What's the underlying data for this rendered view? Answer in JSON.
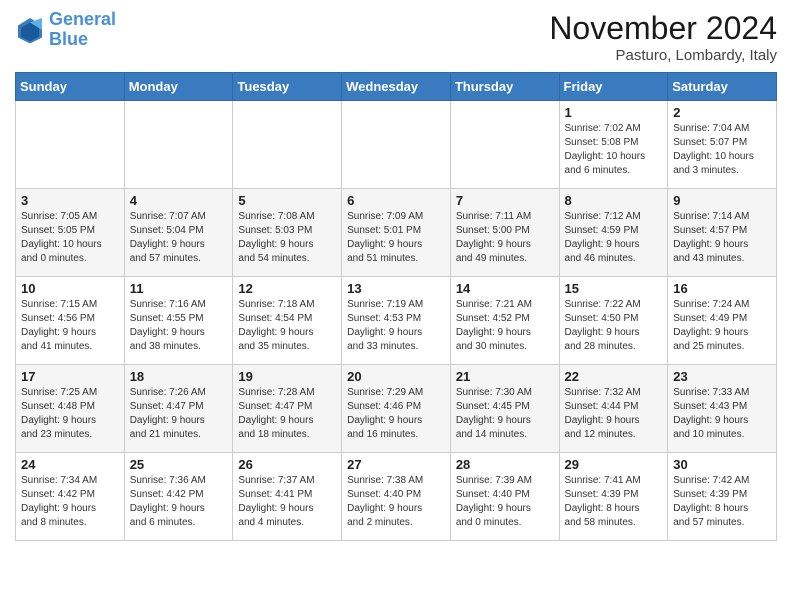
{
  "header": {
    "logo_line1": "General",
    "logo_line2": "Blue",
    "month_title": "November 2024",
    "location": "Pasturo, Lombardy, Italy"
  },
  "weekdays": [
    "Sunday",
    "Monday",
    "Tuesday",
    "Wednesday",
    "Thursday",
    "Friday",
    "Saturday"
  ],
  "weeks": [
    [
      {
        "day": "",
        "info": ""
      },
      {
        "day": "",
        "info": ""
      },
      {
        "day": "",
        "info": ""
      },
      {
        "day": "",
        "info": ""
      },
      {
        "day": "",
        "info": ""
      },
      {
        "day": "1",
        "info": "Sunrise: 7:02 AM\nSunset: 5:08 PM\nDaylight: 10 hours\nand 6 minutes."
      },
      {
        "day": "2",
        "info": "Sunrise: 7:04 AM\nSunset: 5:07 PM\nDaylight: 10 hours\nand 3 minutes."
      }
    ],
    [
      {
        "day": "3",
        "info": "Sunrise: 7:05 AM\nSunset: 5:05 PM\nDaylight: 10 hours\nand 0 minutes."
      },
      {
        "day": "4",
        "info": "Sunrise: 7:07 AM\nSunset: 5:04 PM\nDaylight: 9 hours\nand 57 minutes."
      },
      {
        "day": "5",
        "info": "Sunrise: 7:08 AM\nSunset: 5:03 PM\nDaylight: 9 hours\nand 54 minutes."
      },
      {
        "day": "6",
        "info": "Sunrise: 7:09 AM\nSunset: 5:01 PM\nDaylight: 9 hours\nand 51 minutes."
      },
      {
        "day": "7",
        "info": "Sunrise: 7:11 AM\nSunset: 5:00 PM\nDaylight: 9 hours\nand 49 minutes."
      },
      {
        "day": "8",
        "info": "Sunrise: 7:12 AM\nSunset: 4:59 PM\nDaylight: 9 hours\nand 46 minutes."
      },
      {
        "day": "9",
        "info": "Sunrise: 7:14 AM\nSunset: 4:57 PM\nDaylight: 9 hours\nand 43 minutes."
      }
    ],
    [
      {
        "day": "10",
        "info": "Sunrise: 7:15 AM\nSunset: 4:56 PM\nDaylight: 9 hours\nand 41 minutes."
      },
      {
        "day": "11",
        "info": "Sunrise: 7:16 AM\nSunset: 4:55 PM\nDaylight: 9 hours\nand 38 minutes."
      },
      {
        "day": "12",
        "info": "Sunrise: 7:18 AM\nSunset: 4:54 PM\nDaylight: 9 hours\nand 35 minutes."
      },
      {
        "day": "13",
        "info": "Sunrise: 7:19 AM\nSunset: 4:53 PM\nDaylight: 9 hours\nand 33 minutes."
      },
      {
        "day": "14",
        "info": "Sunrise: 7:21 AM\nSunset: 4:52 PM\nDaylight: 9 hours\nand 30 minutes."
      },
      {
        "day": "15",
        "info": "Sunrise: 7:22 AM\nSunset: 4:50 PM\nDaylight: 9 hours\nand 28 minutes."
      },
      {
        "day": "16",
        "info": "Sunrise: 7:24 AM\nSunset: 4:49 PM\nDaylight: 9 hours\nand 25 minutes."
      }
    ],
    [
      {
        "day": "17",
        "info": "Sunrise: 7:25 AM\nSunset: 4:48 PM\nDaylight: 9 hours\nand 23 minutes."
      },
      {
        "day": "18",
        "info": "Sunrise: 7:26 AM\nSunset: 4:47 PM\nDaylight: 9 hours\nand 21 minutes."
      },
      {
        "day": "19",
        "info": "Sunrise: 7:28 AM\nSunset: 4:47 PM\nDaylight: 9 hours\nand 18 minutes."
      },
      {
        "day": "20",
        "info": "Sunrise: 7:29 AM\nSunset: 4:46 PM\nDaylight: 9 hours\nand 16 minutes."
      },
      {
        "day": "21",
        "info": "Sunrise: 7:30 AM\nSunset: 4:45 PM\nDaylight: 9 hours\nand 14 minutes."
      },
      {
        "day": "22",
        "info": "Sunrise: 7:32 AM\nSunset: 4:44 PM\nDaylight: 9 hours\nand 12 minutes."
      },
      {
        "day": "23",
        "info": "Sunrise: 7:33 AM\nSunset: 4:43 PM\nDaylight: 9 hours\nand 10 minutes."
      }
    ],
    [
      {
        "day": "24",
        "info": "Sunrise: 7:34 AM\nSunset: 4:42 PM\nDaylight: 9 hours\nand 8 minutes."
      },
      {
        "day": "25",
        "info": "Sunrise: 7:36 AM\nSunset: 4:42 PM\nDaylight: 9 hours\nand 6 minutes."
      },
      {
        "day": "26",
        "info": "Sunrise: 7:37 AM\nSunset: 4:41 PM\nDaylight: 9 hours\nand 4 minutes."
      },
      {
        "day": "27",
        "info": "Sunrise: 7:38 AM\nSunset: 4:40 PM\nDaylight: 9 hours\nand 2 minutes."
      },
      {
        "day": "28",
        "info": "Sunrise: 7:39 AM\nSunset: 4:40 PM\nDaylight: 9 hours\nand 0 minutes."
      },
      {
        "day": "29",
        "info": "Sunrise: 7:41 AM\nSunset: 4:39 PM\nDaylight: 8 hours\nand 58 minutes."
      },
      {
        "day": "30",
        "info": "Sunrise: 7:42 AM\nSunset: 4:39 PM\nDaylight: 8 hours\nand 57 minutes."
      }
    ]
  ]
}
